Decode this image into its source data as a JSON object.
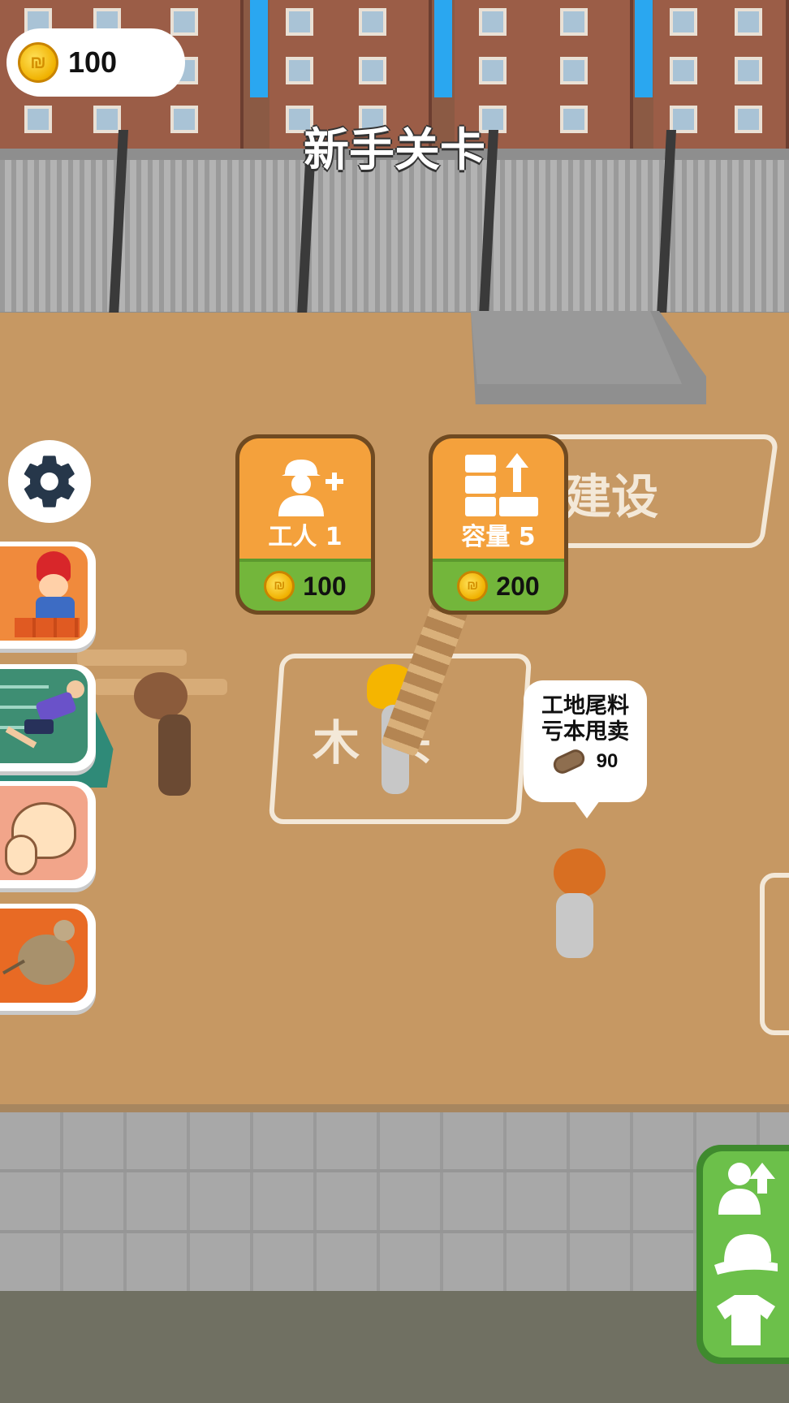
{
  "hud": {
    "coins": "100",
    "level_title": "新手关卡"
  },
  "upgrades": [
    {
      "label": "工人 1",
      "price": "100",
      "icon": "add-worker-icon"
    },
    {
      "label": "容量 5",
      "price": "200",
      "icon": "capacity-blocks-icon"
    }
  ],
  "zones": {
    "build_partial": "建设",
    "wood_partial": "木头"
  },
  "sell_bubble": {
    "line1": "工地尾料",
    "line2": "亏本甩卖",
    "price": "90",
    "item_icon": "wood-log-icon"
  },
  "side_buttons": [
    "bricklayer-worker-icon",
    "running-speed-icon",
    "muscle-strength-icon",
    "mouse-icon"
  ],
  "right_panel": [
    "upgrade-character-icon",
    "cap-icon",
    "shirt-icon"
  ],
  "colors": {
    "card_orange": "#f4a13c",
    "card_green": "#73b63b",
    "ground": "#c69863",
    "panel_green": "#6cc04a"
  }
}
